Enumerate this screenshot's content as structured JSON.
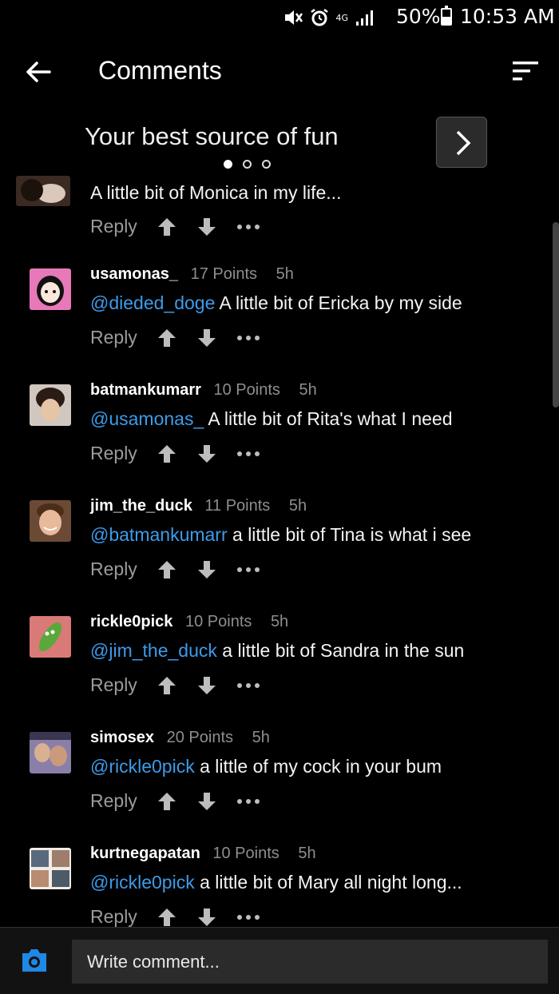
{
  "status_bar": {
    "network": "4G",
    "battery": "50%",
    "battery_level": 0.5,
    "time": "10:53 AM"
  },
  "header": {
    "title": "Comments"
  },
  "banner": {
    "text": "Your best source of fun",
    "page_count": 3,
    "active_page": 1
  },
  "comments": [
    {
      "username": "",
      "points": "",
      "age": "",
      "mention": "",
      "text": "A little bit of Monica in my life...",
      "reply": "Reply"
    },
    {
      "username": "usamonas_",
      "points": "17 Points",
      "age": "5h",
      "mention": "@dieded_doge",
      "text": " A little bit of Ericka by my side",
      "reply": "Reply"
    },
    {
      "username": "batmankumarr",
      "points": "10 Points",
      "age": "5h",
      "mention": "@usamonas_",
      "text": " A little bit of Rita's what I need",
      "reply": "Reply"
    },
    {
      "username": "jim_the_duck",
      "points": "11 Points",
      "age": "5h",
      "mention": "@batmankumarr",
      "text": " a little bit of Tina is what i see",
      "reply": "Reply"
    },
    {
      "username": "rickle0pick",
      "points": "10 Points",
      "age": "5h",
      "mention": "@jim_the_duck",
      "text": " a little bit of Sandra in the sun",
      "reply": "Reply"
    },
    {
      "username": "simosex",
      "points": "20 Points",
      "age": "5h",
      "mention": "@rickle0pick",
      "text": " a little of my cock in your bum",
      "reply": "Reply"
    },
    {
      "username": "kurtnegapatan",
      "points": "10 Points",
      "age": "5h",
      "mention": "@rickle0pick",
      "text": " a little bit of Mary all night long...",
      "reply": "Reply"
    }
  ],
  "composer": {
    "placeholder": "Write comment..."
  },
  "colors": {
    "mention": "#3d9be9",
    "accent_camera": "#1e88e5"
  }
}
